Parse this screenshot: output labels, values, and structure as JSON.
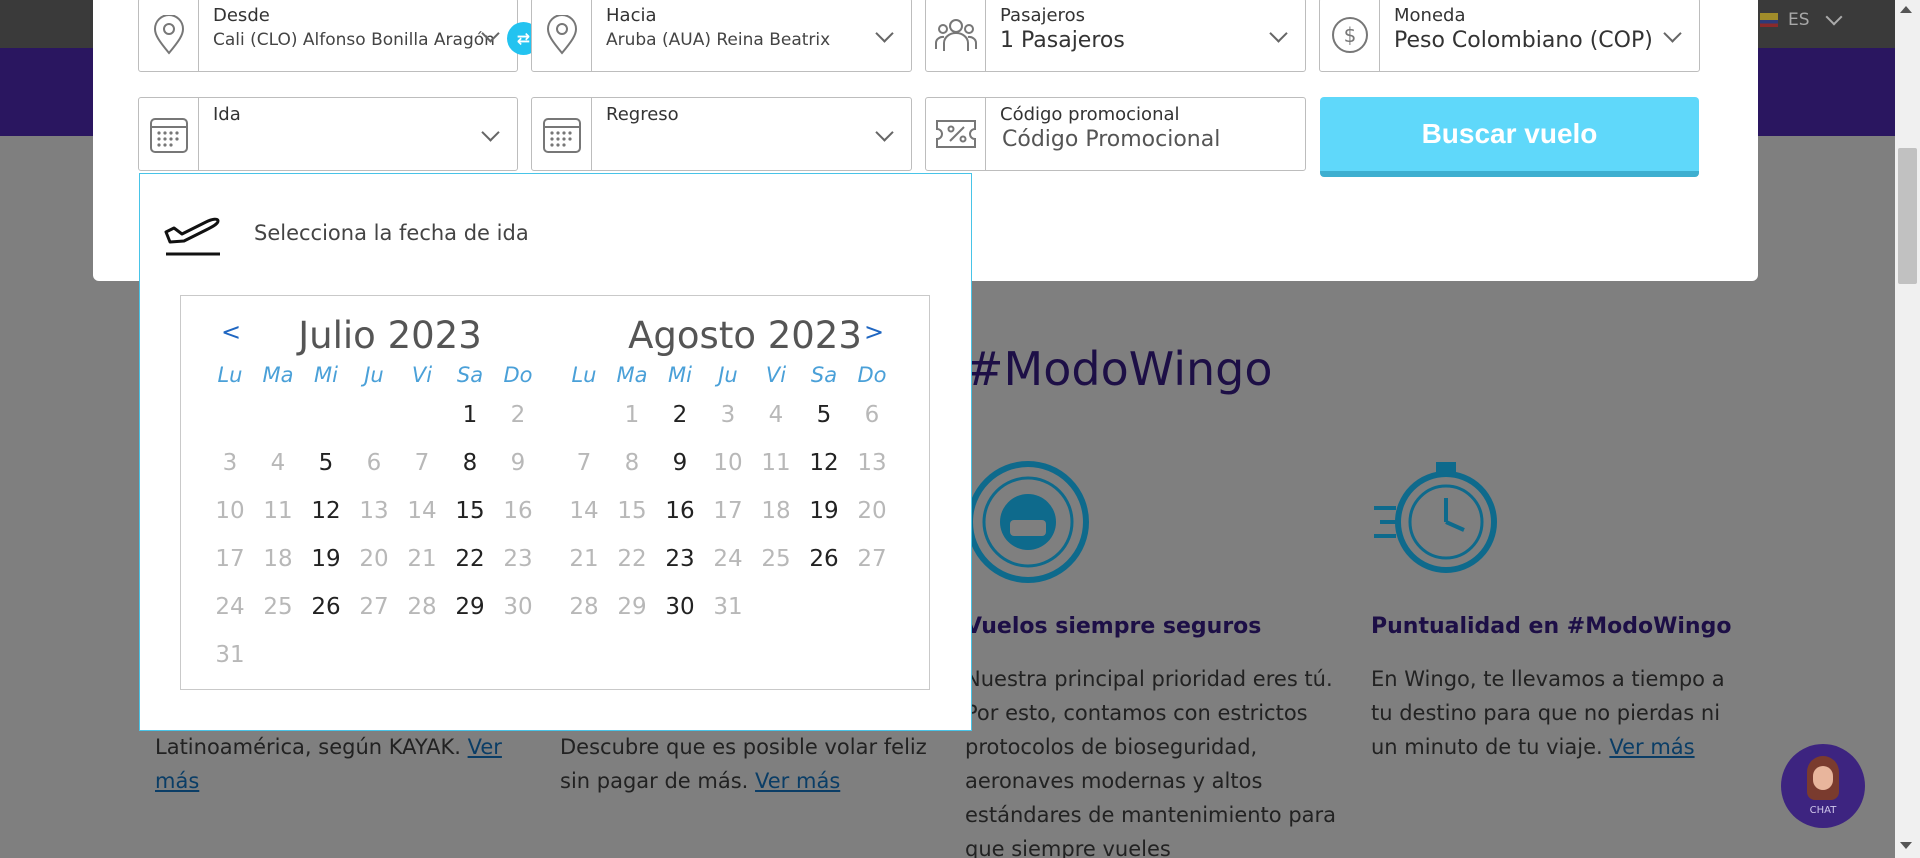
{
  "header": {
    "language": "ES"
  },
  "search": {
    "from": {
      "label": "Desde",
      "value": "Cali (CLO) Alfonso Bonilla Aragón"
    },
    "to": {
      "label": "Hacia",
      "value": "Aruba (AUA) Reina Beatrix"
    },
    "passengers": {
      "label": "Pasajeros",
      "value": "1 Pasajeros"
    },
    "currency": {
      "label": "Moneda",
      "value": "Peso Colombiano (COP)"
    },
    "departure": {
      "label": "Ida",
      "value": ""
    },
    "return": {
      "label": "Regreso",
      "value": ""
    },
    "promo": {
      "label": "Código promocional",
      "placeholder": "Código Promocional"
    },
    "submit_label": "Buscar vuelo"
  },
  "calendar": {
    "title": "Selecciona la fecha de ida",
    "prev_label": "<",
    "next_label": ">",
    "weekdays": [
      "Lu",
      "Ma",
      "Mi",
      "Ju",
      "Vi",
      "Sa",
      "Do"
    ],
    "months": [
      {
        "title": "Julio 2023",
        "weeks": [
          [
            null,
            null,
            null,
            null,
            null,
            {
              "d": "1",
              "on": true
            },
            {
              "d": "2",
              "on": false
            }
          ],
          [
            {
              "d": "3",
              "on": false
            },
            {
              "d": "4",
              "on": false
            },
            {
              "d": "5",
              "on": true
            },
            {
              "d": "6",
              "on": false
            },
            {
              "d": "7",
              "on": false
            },
            {
              "d": "8",
              "on": true
            },
            {
              "d": "9",
              "on": false
            }
          ],
          [
            {
              "d": "10",
              "on": false
            },
            {
              "d": "11",
              "on": false
            },
            {
              "d": "12",
              "on": true
            },
            {
              "d": "13",
              "on": false
            },
            {
              "d": "14",
              "on": false
            },
            {
              "d": "15",
              "on": true
            },
            {
              "d": "16",
              "on": false
            }
          ],
          [
            {
              "d": "17",
              "on": false
            },
            {
              "d": "18",
              "on": false
            },
            {
              "d": "19",
              "on": true
            },
            {
              "d": "20",
              "on": false
            },
            {
              "d": "21",
              "on": false
            },
            {
              "d": "22",
              "on": true
            },
            {
              "d": "23",
              "on": false
            }
          ],
          [
            {
              "d": "24",
              "on": false
            },
            {
              "d": "25",
              "on": false
            },
            {
              "d": "26",
              "on": true
            },
            {
              "d": "27",
              "on": false
            },
            {
              "d": "28",
              "on": false
            },
            {
              "d": "29",
              "on": true
            },
            {
              "d": "30",
              "on": false
            }
          ],
          [
            {
              "d": "31",
              "on": false
            },
            null,
            null,
            null,
            null,
            null,
            null
          ]
        ]
      },
      {
        "title": "Agosto 2023",
        "weeks": [
          [
            null,
            {
              "d": "1",
              "on": false
            },
            {
              "d": "2",
              "on": true
            },
            {
              "d": "3",
              "on": false
            },
            {
              "d": "4",
              "on": false
            },
            {
              "d": "5",
              "on": true
            },
            {
              "d": "6",
              "on": false
            }
          ],
          [
            {
              "d": "7",
              "on": false
            },
            {
              "d": "8",
              "on": false
            },
            {
              "d": "9",
              "on": true
            },
            {
              "d": "10",
              "on": false
            },
            {
              "d": "11",
              "on": false
            },
            {
              "d": "12",
              "on": true
            },
            {
              "d": "13",
              "on": false
            }
          ],
          [
            {
              "d": "14",
              "on": false
            },
            {
              "d": "15",
              "on": false
            },
            {
              "d": "16",
              "on": true
            },
            {
              "d": "17",
              "on": false
            },
            {
              "d": "18",
              "on": false
            },
            {
              "d": "19",
              "on": true
            },
            {
              "d": "20",
              "on": false
            }
          ],
          [
            {
              "d": "21",
              "on": false
            },
            {
              "d": "22",
              "on": false
            },
            {
              "d": "23",
              "on": true
            },
            {
              "d": "24",
              "on": false
            },
            {
              "d": "25",
              "on": false
            },
            {
              "d": "26",
              "on": true
            },
            {
              "d": "27",
              "on": false
            }
          ],
          [
            {
              "d": "28",
              "on": false
            },
            {
              "d": "29",
              "on": false
            },
            {
              "d": "30",
              "on": true
            },
            {
              "d": "31",
              "on": false
            },
            null,
            null,
            null
          ]
        ]
      }
    ]
  },
  "background": {
    "section_title": "#ModoWingo",
    "features": [
      {
        "title": "",
        "text": "Latinoamérica, según KAYAK.",
        "link": "Ver más"
      },
      {
        "title": "",
        "text": "Descubre que es posible volar feliz sin pagar de más.",
        "link": "Ver más"
      },
      {
        "title": "Vuelos siempre seguros",
        "text": "Nuestra principal prioridad eres tú. Por esto, contamos con estrictos protocolos de bioseguridad, aeronaves modernas y altos estándares de mantenimiento para que siempre vueles",
        "link": ""
      },
      {
        "title": "Puntualidad en #ModoWingo",
        "text": "En Wingo, te llevamos a tiempo a tu destino para que no pierdas ni un minuto de tu viaje.",
        "link": "Ver más"
      }
    ],
    "chat_label": "CHAT"
  },
  "colors": {
    "accent": "#5fd8fa",
    "brand_purple": "#2a1660",
    "link_blue": "#1f66c1"
  }
}
